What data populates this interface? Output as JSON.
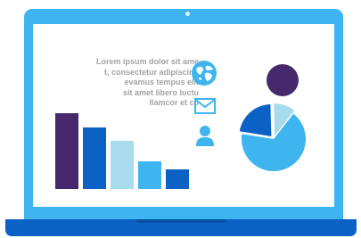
{
  "screen": {
    "paragraph_lines": [
      "Lorem ipsum dolor sit ame",
      "t, consectetur adipiscing",
      "evamus tempus elit",
      "sit amet libero luctu",
      "llamcor et co"
    ]
  },
  "icons": [
    "globe-icon",
    "envelope-icon",
    "user-icon"
  ],
  "colors": {
    "frame": "#3eb5ef",
    "base": "#0b62c4",
    "purple": "#45296c",
    "blue": "#0b62c4",
    "light_blue": "#a7dcef",
    "sky_blue": "#3eb5ef",
    "text": "#a3a3a3"
  },
  "chart_data": [
    {
      "type": "bar",
      "categories": [
        "",
        "",
        "",
        "",
        ""
      ],
      "values": [
        85,
        69,
        54,
        31,
        22
      ],
      "colors": [
        "#45296c",
        "#0b62c4",
        "#a7dcef",
        "#3eb5ef",
        "#0b62c4"
      ]
    },
    {
      "type": "pie",
      "values": [
        67,
        22,
        11
      ],
      "colors": [
        "#3eb5ef",
        "#0b62c4",
        "#a7dcef"
      ]
    }
  ]
}
